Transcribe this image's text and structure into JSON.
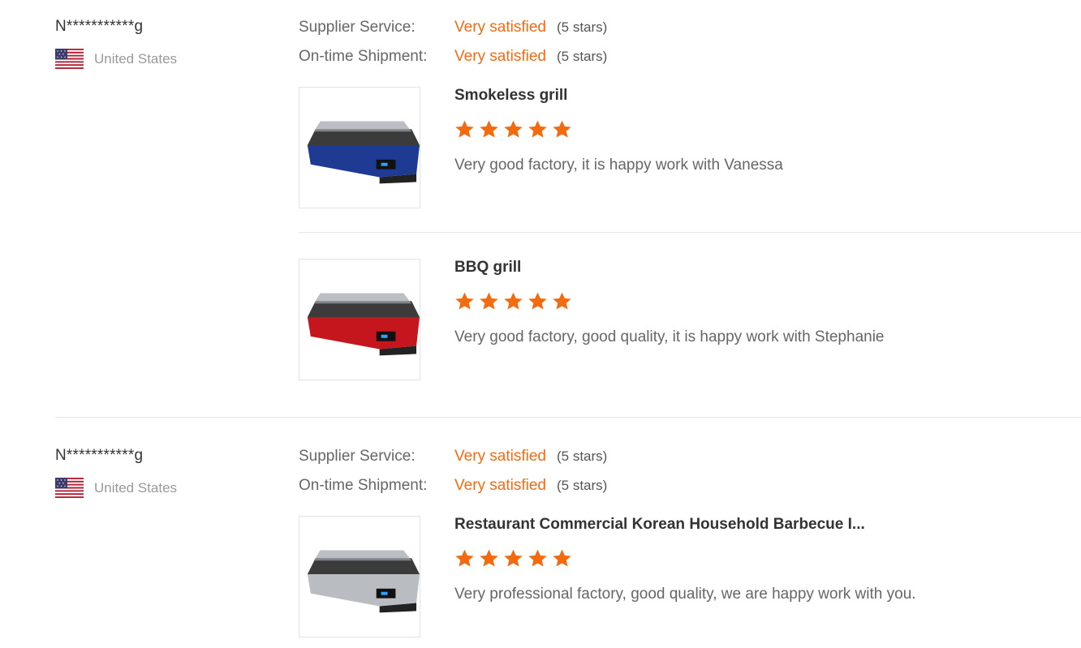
{
  "colors": {
    "accent": "#f36b10",
    "star": "#f36b10",
    "divider": "#e5e5e5",
    "muted": "#999999"
  },
  "reviews": [
    {
      "buyer": {
        "name": "N***********g",
        "country": "United States",
        "flag_icon": "us-flag-icon"
      },
      "ratings": [
        {
          "label": "Supplier Service:",
          "value": "Very satisfied",
          "stars_text": "(5 stars)"
        },
        {
          "label": "On-time Shipment:",
          "value": "Very satisfied",
          "stars_text": "(5 stars)"
        }
      ],
      "products": [
        {
          "title": "Smokeless grill",
          "stars": 5,
          "comment": "Very good factory, it is happy work with Vanessa",
          "image_icon": "blue-grill-image",
          "color": "#1f3a93"
        },
        {
          "title": "BBQ grill",
          "stars": 5,
          "comment": "Very good factory, good quality, it is happy work with Stephanie",
          "image_icon": "red-grill-image",
          "color": "#c4161c"
        }
      ]
    },
    {
      "buyer": {
        "name": "N***********g",
        "country": "United States",
        "flag_icon": "us-flag-icon"
      },
      "ratings": [
        {
          "label": "Supplier Service:",
          "value": "Very satisfied",
          "stars_text": "(5 stars)"
        },
        {
          "label": "On-time Shipment:",
          "value": "Very satisfied",
          "stars_text": "(5 stars)"
        }
      ],
      "products": [
        {
          "title": "Restaurant Commercial Korean Household Barbecue I...",
          "stars": 5,
          "comment": "Very professional factory, good quality, we are happy work with you.",
          "image_icon": "silver-grill-image",
          "color": "#b9bcc0"
        }
      ]
    }
  ]
}
